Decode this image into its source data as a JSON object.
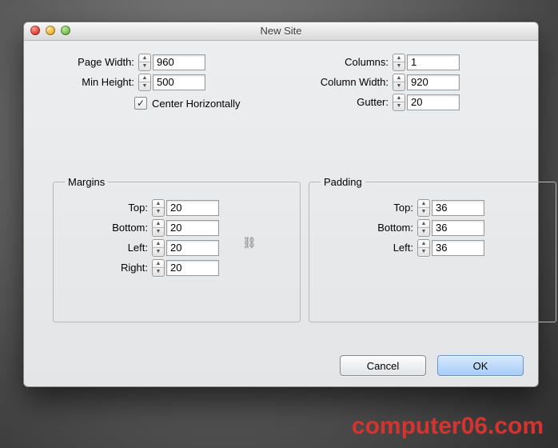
{
  "dialog": {
    "title": "New Site",
    "page_width": {
      "label": "Page Width:",
      "value": "960"
    },
    "min_height": {
      "label": "Min Height:",
      "value": "500"
    },
    "center_horizontally": {
      "label": "Center Horizontally",
      "checked": true
    },
    "columns": {
      "label": "Columns:",
      "value": "1"
    },
    "column_width": {
      "label": "Column Width:",
      "value": "920"
    },
    "gutter": {
      "label": "Gutter:",
      "value": "20"
    },
    "margins": {
      "legend": "Margins",
      "top": {
        "label": "Top:",
        "value": "20"
      },
      "bottom": {
        "label": "Bottom:",
        "value": "20"
      },
      "left": {
        "label": "Left:",
        "value": "20"
      },
      "right": {
        "label": "Right:",
        "value": "20"
      }
    },
    "padding": {
      "legend": "Padding",
      "top": {
        "label": "Top:",
        "value": "36"
      },
      "bottom": {
        "label": "Bottom:",
        "value": "36"
      },
      "left": {
        "label": "Left:",
        "value": "36"
      }
    },
    "buttons": {
      "cancel": "Cancel",
      "ok": "OK"
    }
  },
  "watermark": "computer06.com"
}
